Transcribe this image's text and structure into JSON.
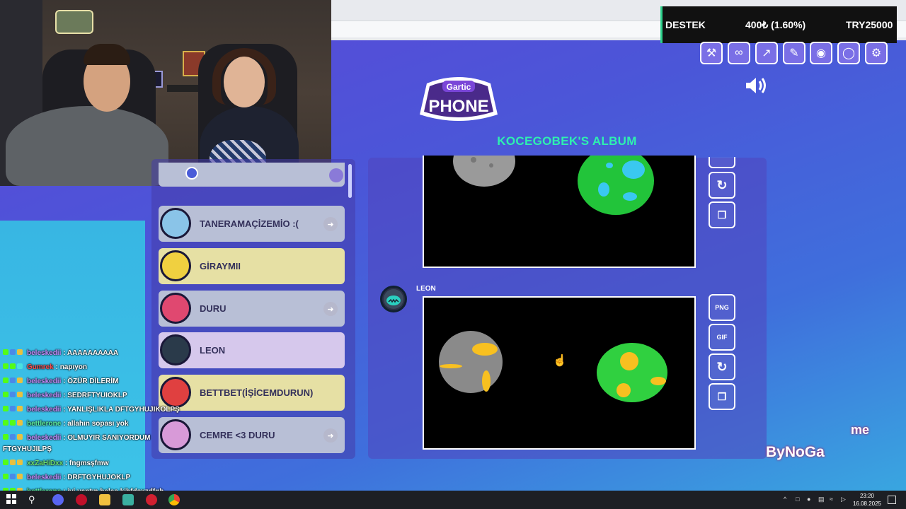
{
  "donation": {
    "label": "DESTEK",
    "progress": "400₺ (1.60%)",
    "goal": "TRY25000",
    "accent": "#2ad08a"
  },
  "game": {
    "logo_top": "Gartic",
    "logo_bottom": "PHONE",
    "album_title": "KOCEGOBEK'S ALBUM",
    "toolbar_icons": [
      "hammer-icon",
      "link-icon",
      "external-link-icon",
      "edit-icon",
      "eye-icon",
      "shield-icon",
      "gear-icon"
    ],
    "players": [
      {
        "name": "TANERAMAÇİZEMİO :(",
        "color": "#b8bfd6",
        "kick": true
      },
      {
        "name": "GİRAYMII",
        "color": "#e6e0a4",
        "kick": false
      },
      {
        "name": "DURU",
        "color": "#b8bfd6",
        "kick": true
      },
      {
        "name": "LEON",
        "color": "#d6c8ec",
        "kick": false
      },
      {
        "name": "BETTBET(İŞİCEMDURUN)",
        "color": "#e6e0a4",
        "kick": false
      },
      {
        "name": "CEMRE <3 DURU",
        "color": "#b8bfd6",
        "kick": true
      }
    ],
    "album_author": "LEON",
    "download_buttons": {
      "png": "PNG",
      "gif": "GIF"
    }
  },
  "chat": [
    {
      "user": "beleskedii",
      "msg": "AAAAAAAAAA",
      "color": "#c58cff"
    },
    {
      "user": "Gumrek",
      "msg": "napıyon",
      "color": "#ff4d4d"
    },
    {
      "user": "beleskedii",
      "msg": "ÖZÜR DİLERİM",
      "color": "#c58cff"
    },
    {
      "user": "beleskedii",
      "msg": "SEDRFTYUIOKLP",
      "color": "#c58cff"
    },
    {
      "user": "beleskedii",
      "msg": "YANLIŞLIKLA DFTGYHUJIKOLPŞ",
      "color": "#c58cff"
    },
    {
      "user": "bettlerone",
      "msg": "allahın sopası yok",
      "color": "#5ef0a0"
    },
    {
      "user": "beleskedii",
      "msg": "OLMUYIR SANIYORDUM",
      "color": "#c58cff"
    },
    {
      "user": "",
      "msg": "FTGYHUJILPŞ",
      "color": "#ffffff"
    },
    {
      "user": "xxZaHiDxx",
      "msg": "fngmsşfmw",
      "color": "#6fe06f"
    },
    {
      "user": "beleskedii",
      "msg": "DRFTGYHUJOKLP",
      "color": "#c58cff"
    },
    {
      "user": "bettlerone",
      "msg": "iyi yaptın beles kjhfdsxzdfgh",
      "color": "#5ef0a0"
    }
  ],
  "watermark": {
    "text": "ByNoGa",
    "suffix": "me"
  },
  "taskbar": {
    "time": "23:20",
    "date": "16.08.2025"
  }
}
